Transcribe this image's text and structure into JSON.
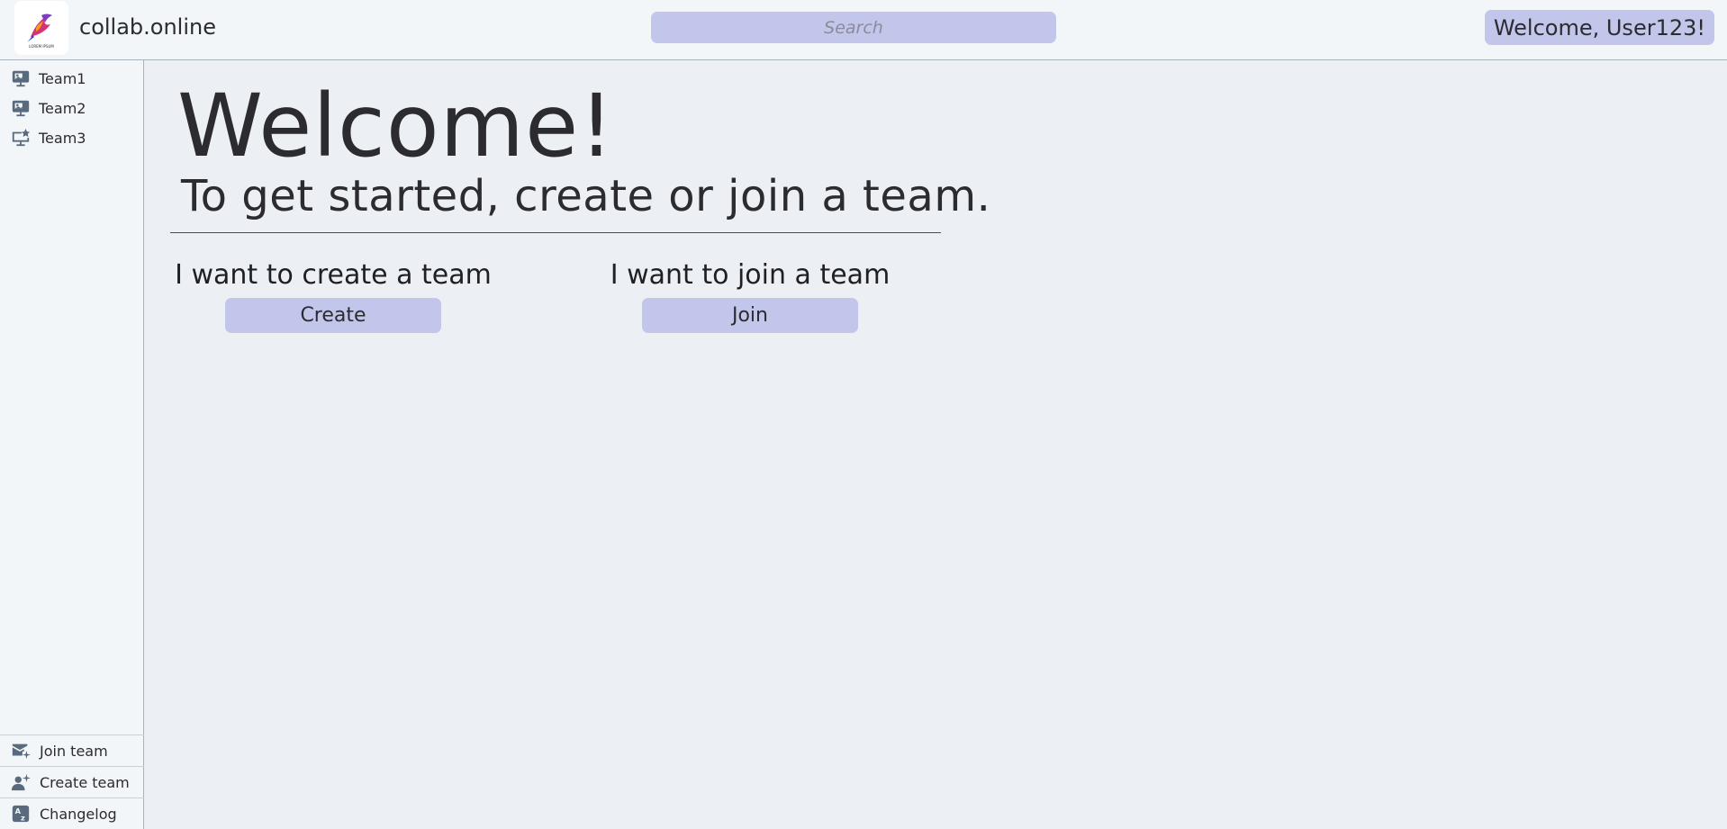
{
  "header": {
    "app_name": "collab.online",
    "logo_text": "LOREM IPSUM",
    "search_placeholder": "Search",
    "welcome_user": "Welcome, User123!"
  },
  "sidebar": {
    "teams": [
      {
        "label": "Team1",
        "icon": "presentation-screen-icon"
      },
      {
        "label": "Team2",
        "icon": "presentation-screen-icon"
      },
      {
        "label": "Team3",
        "icon": "starred-monitor-icon"
      }
    ],
    "bottom_items": [
      {
        "label": "Join team",
        "icon": "join-envelope-icon"
      },
      {
        "label": "Create team",
        "icon": "create-team-icon"
      },
      {
        "label": "Changelog",
        "icon": "changelog-az-icon"
      }
    ]
  },
  "main": {
    "title": "Welcome!",
    "subtitle": "To get started, create or join a team.",
    "create": {
      "label": "I want to create a team",
      "button": "Create"
    },
    "join": {
      "label": "I want to join a team",
      "button": "Join"
    }
  },
  "colors": {
    "accent": "#c3c6eb",
    "icon": "#5a6a7e",
    "background": "#ecf0f4",
    "panel": "#f3f6f9"
  }
}
